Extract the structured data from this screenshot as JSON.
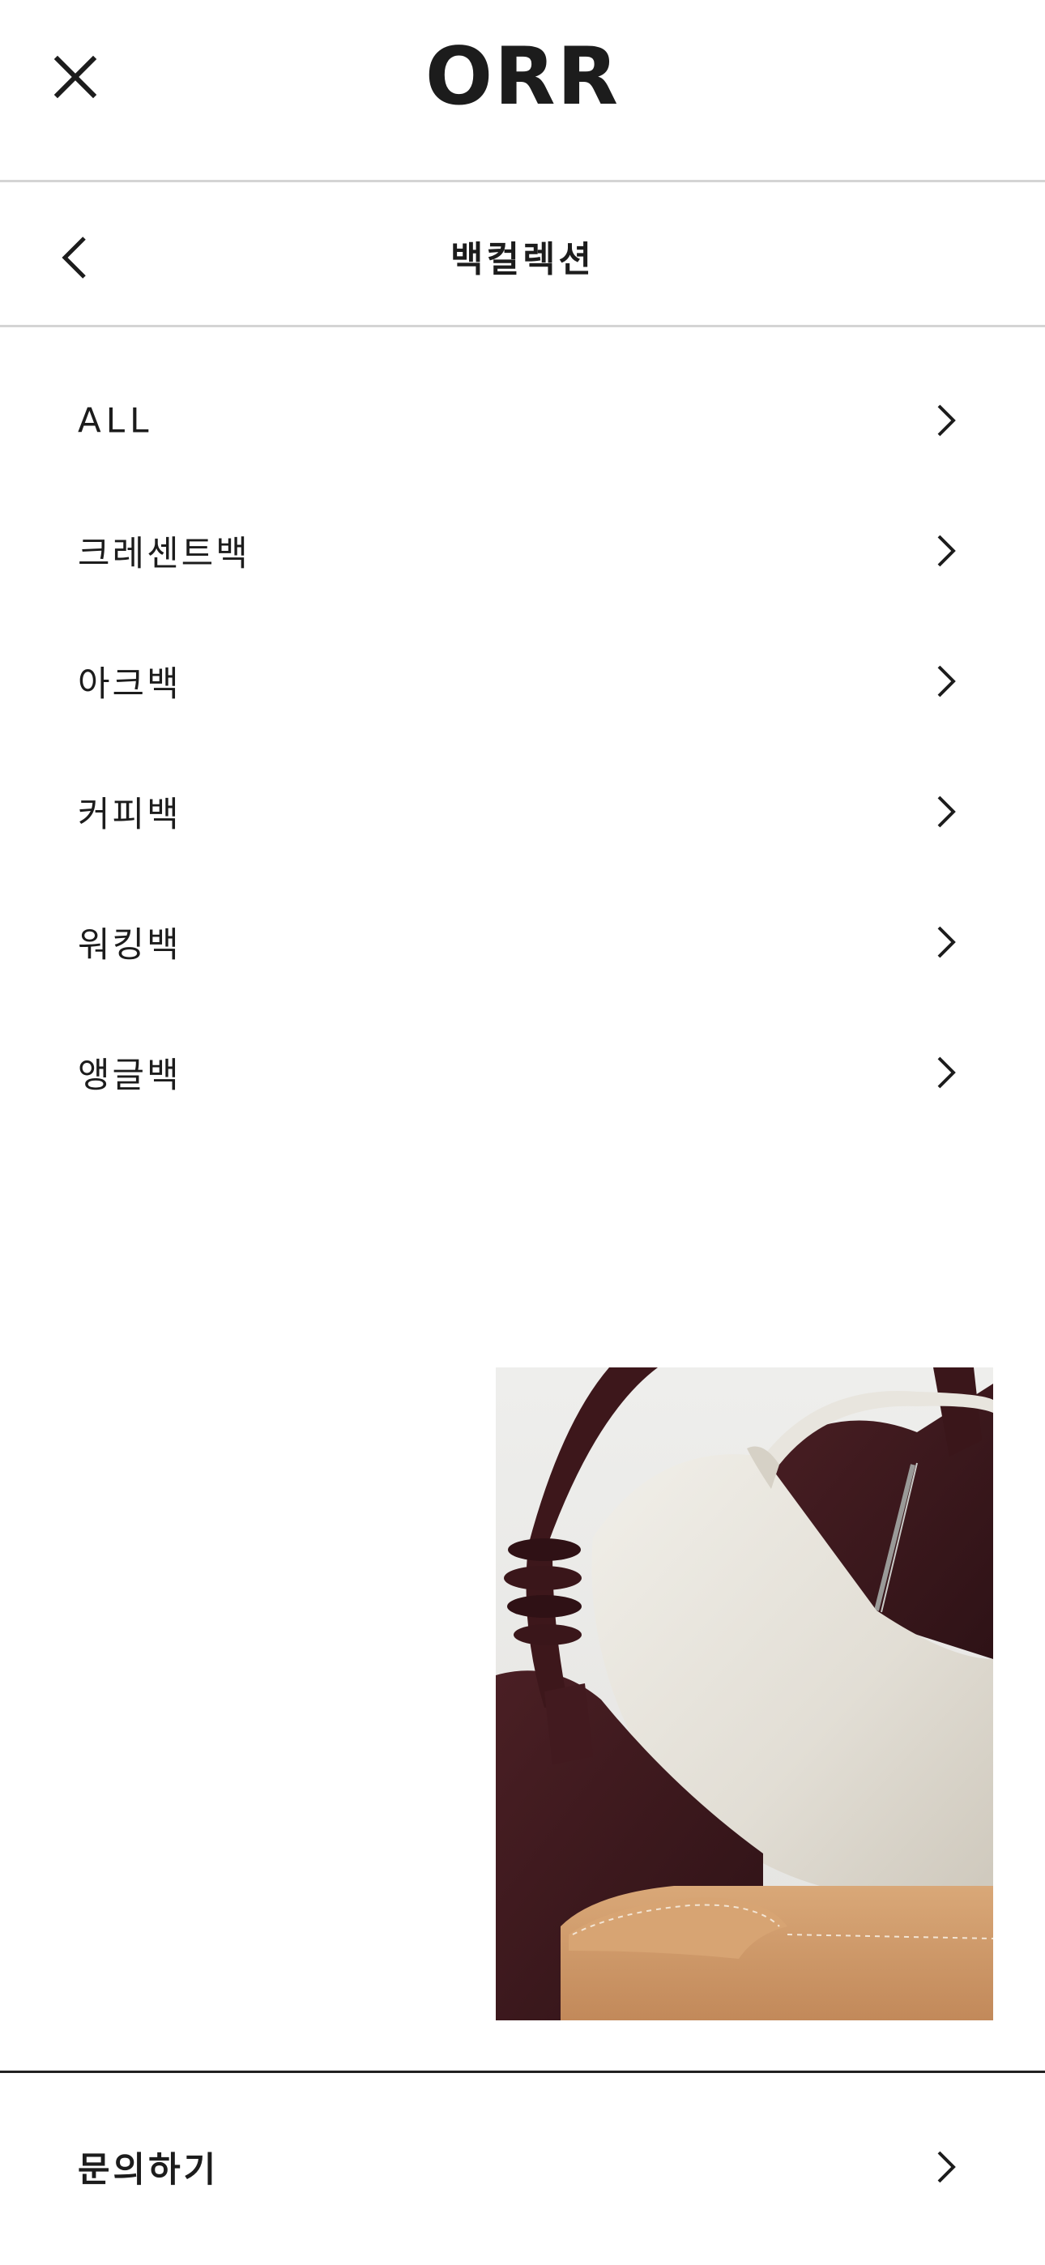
{
  "header": {
    "logo": "ORR",
    "close_icon": "close-icon"
  },
  "subheader": {
    "title": "백컬렉션",
    "back_icon": "chevron-left-icon"
  },
  "menu": {
    "items": [
      {
        "label": "ALL"
      },
      {
        "label": "크레센트백"
      },
      {
        "label": "아크백"
      },
      {
        "label": "커피백"
      },
      {
        "label": "워킹백"
      },
      {
        "label": "앵글백"
      }
    ],
    "item_icon": "chevron-right-icon"
  },
  "promo": {
    "image": "bag-product-photo"
  },
  "footer": {
    "inquiry_label": "문의하기",
    "inquiry_icon": "chevron-right-icon"
  },
  "colors": {
    "text": "#1c1c1c",
    "divider": "#d4d4d4",
    "footer_rule": "#222222",
    "background": "#ffffff"
  }
}
